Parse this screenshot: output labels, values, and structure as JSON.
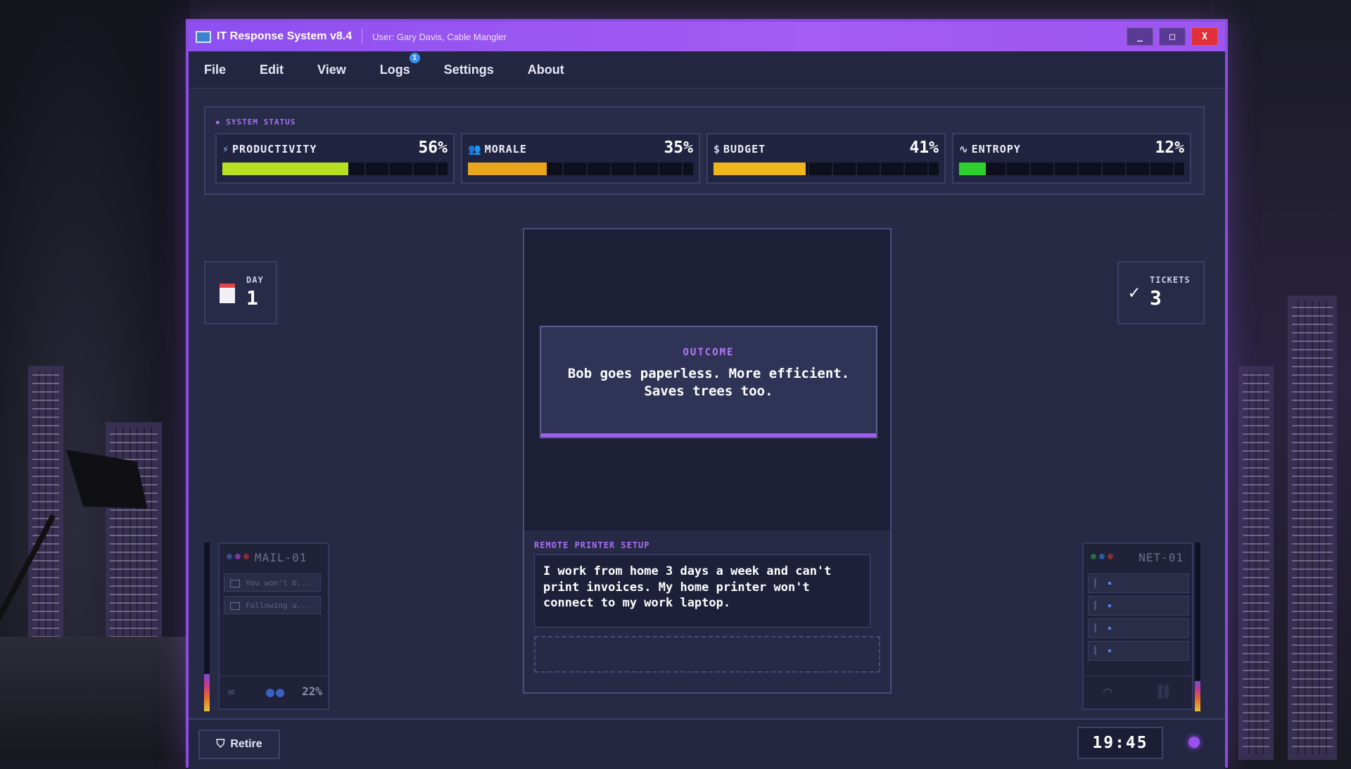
{
  "window": {
    "title": "IT Response System v8.4",
    "user": "User: Gary Davis, Cable Mangler",
    "controls": {
      "minimize": "_",
      "maximize": "□",
      "close": "X"
    }
  },
  "menu": {
    "items": [
      "File",
      "Edit",
      "View",
      "Logs",
      "Settings",
      "About"
    ],
    "logs_badge": "1"
  },
  "system_status": {
    "label": "SYSTEM STATUS",
    "stats": [
      {
        "name": "PRODUCTIVITY",
        "value": "56%",
        "level": 0.56,
        "icon": "lightning-icon",
        "color": "#b7e021"
      },
      {
        "name": "MORALE",
        "value": "35%",
        "level": 0.35,
        "icon": "people-icon",
        "color": "#e8a41a"
      },
      {
        "name": "BUDGET",
        "value": "41%",
        "level": 0.41,
        "icon": "dollar-icon",
        "color": "#f0b51c"
      },
      {
        "name": "ENTROPY",
        "value": "12%",
        "level": 0.12,
        "icon": "pulse-icon",
        "color": "#2ed02e"
      }
    ]
  },
  "day": {
    "label": "DAY",
    "value": "1"
  },
  "tickets": {
    "label": "TICKETS",
    "value": "3"
  },
  "outcome": {
    "label": "OUTCOME",
    "text": "Bob goes paperless. More efficient. Saves trees too."
  },
  "ticket": {
    "title": "REMOTE PRINTER SETUP",
    "body": "I work from home 3 days a week and can't print invoices. My home printer won't connect to my work laptop."
  },
  "mail_device": {
    "name": "MAIL-01",
    "rows": [
      "You won't b...",
      "Following u..."
    ],
    "percent": "22%",
    "meter_level": 0.22
  },
  "net_device": {
    "name": "NET-01",
    "meter_level": 0.18
  },
  "footer": {
    "retire": "Retire",
    "clock": "19:45"
  }
}
